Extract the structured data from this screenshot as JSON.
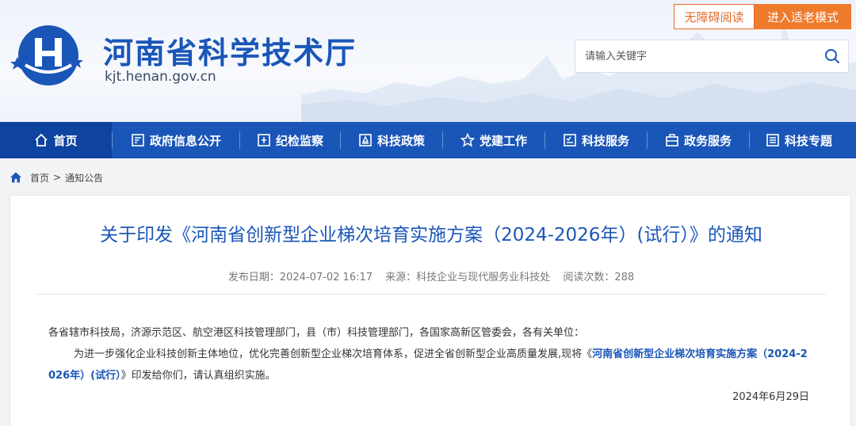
{
  "header": {
    "title": "河南省科学技术厅",
    "url": "kjt.henan.gov.cn",
    "accessibility_label": "无障碍阅读",
    "elder_mode_label": "进入适老模式",
    "search_placeholder": "请输入关键字"
  },
  "nav": {
    "items": [
      {
        "label": "首页",
        "icon": "home-icon"
      },
      {
        "label": "政府信息公开",
        "icon": "document-icon"
      },
      {
        "label": "纪检监察",
        "icon": "badge-icon"
      },
      {
        "label": "科技政策",
        "icon": "policy-icon"
      },
      {
        "label": "党建工作",
        "icon": "star-icon"
      },
      {
        "label": "科技服务",
        "icon": "checklist-icon"
      },
      {
        "label": "政务服务",
        "icon": "briefcase-icon"
      },
      {
        "label": "科技专题",
        "icon": "list-icon"
      }
    ]
  },
  "breadcrumb": {
    "home": "首页",
    "separator": ">",
    "current": "通知公告"
  },
  "article": {
    "title": "关于印发《河南省创新型企业梯次培育实施方案（2024-2026年）(试行）》的通知",
    "publish_date": "发布日期：2024-07-02 16:17",
    "source": "来源：科技企业与现代服务业科技处",
    "views": "阅读次数：288",
    "para1": "各省辖市科技局，济源示范区、航空港区科技管理部门，县（市）科技管理部门，各国家高新区管委会，各有关单位：",
    "para2_prefix": "为进一步强化企业科技创新主体地位，优化完善创新型企业梯次培育体系，促进全省创新型企业高质量发展,现将《",
    "para2_link": "河南省创新型企业梯次培育实施方案（2024-2",
    "para3_link": "026年）(试行）",
    "para3_suffix": "》印发给你们，请认真组织实施。",
    "date": "2024年6月29日"
  },
  "colors": {
    "brand_blue": "#1a56b8",
    "nav_active": "#0e43a0",
    "orange": "#ee7a2c"
  }
}
